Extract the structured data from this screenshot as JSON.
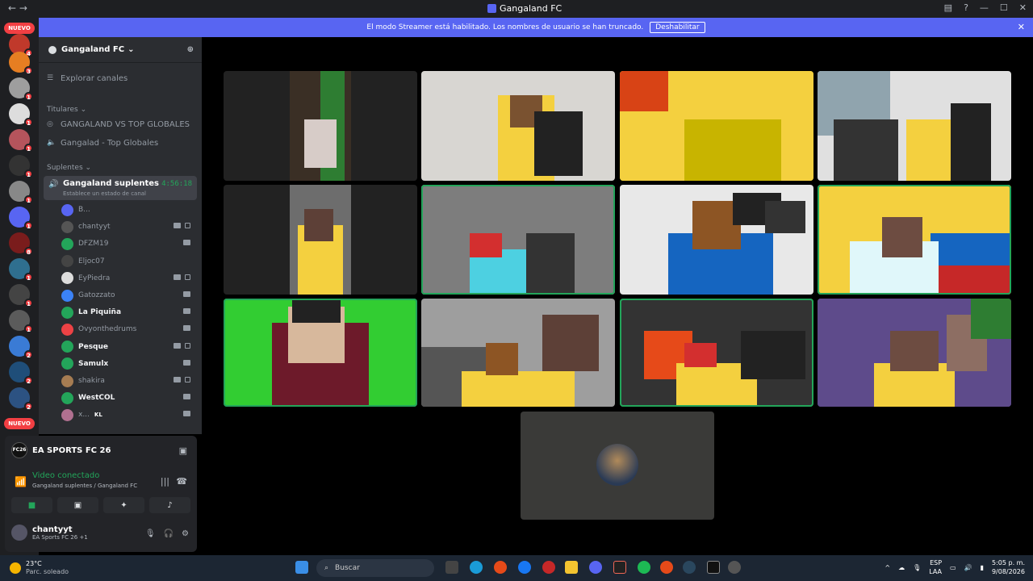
{
  "window": {
    "title": "Gangaland FC"
  },
  "banner": {
    "text": "El modo Streamer está habilitado. Los nombres de usuario se han truncado.",
    "button": "Deshabilitar"
  },
  "servers": {
    "new_label": "NUEVO",
    "badges": [
      "4",
      "3",
      "1",
      "1",
      "1",
      "1",
      "1",
      "1",
      "8",
      "1",
      "1",
      "1",
      "2",
      "2",
      "2"
    ]
  },
  "guild": {
    "name": "Gangaland FC"
  },
  "channels": {
    "explore": "Explorar canales",
    "cat1": "Titulares",
    "ch1": "GANGALAND VS TOP GLOBALES",
    "ch2": "Gangalad - Top Globales",
    "cat2": "Suplentes",
    "voice": {
      "name": "Gangaland suplentes",
      "time": "4:56:18",
      "status": "Establece un estado de canal"
    },
    "users": [
      {
        "name": "B...",
        "bold": false
      },
      {
        "name": "chantyyt",
        "bold": false
      },
      {
        "name": "DFZM19",
        "bold": false
      },
      {
        "name": "Eljoc07",
        "bold": false
      },
      {
        "name": "EyPiedra",
        "bold": false
      },
      {
        "name": "Gatozzato",
        "bold": false
      },
      {
        "name": "La Piquiña",
        "bold": true
      },
      {
        "name": "Ovyonthedrums",
        "bold": false
      },
      {
        "name": "Pesque",
        "bold": true
      },
      {
        "name": "Samulx",
        "bold": true
      },
      {
        "name": "shakira",
        "bold": false
      },
      {
        "name": "WestCOL",
        "bold": true
      },
      {
        "name": "x...",
        "bold": false
      }
    ],
    "kl_tag": "KL"
  },
  "panel": {
    "activity": "EA SPORTS FC 26",
    "activity_logo": "FC26",
    "video": "Video conectado",
    "video_sub": "Gangaland suplentes / Gangaland FC",
    "me": {
      "name": "chantyyt",
      "status": "EA Sports FC 26 +1"
    }
  },
  "taskbar": {
    "temp": "23°C",
    "weather": "Parc. soleado",
    "search": "Buscar",
    "lang1": "ESP",
    "lang2": "LAA",
    "time": "5:05 p. m.",
    "date": "9/08/2026"
  },
  "colors": {
    "accent": "#5865f2",
    "speaking": "#23a55a",
    "badge": "#f23f43"
  }
}
